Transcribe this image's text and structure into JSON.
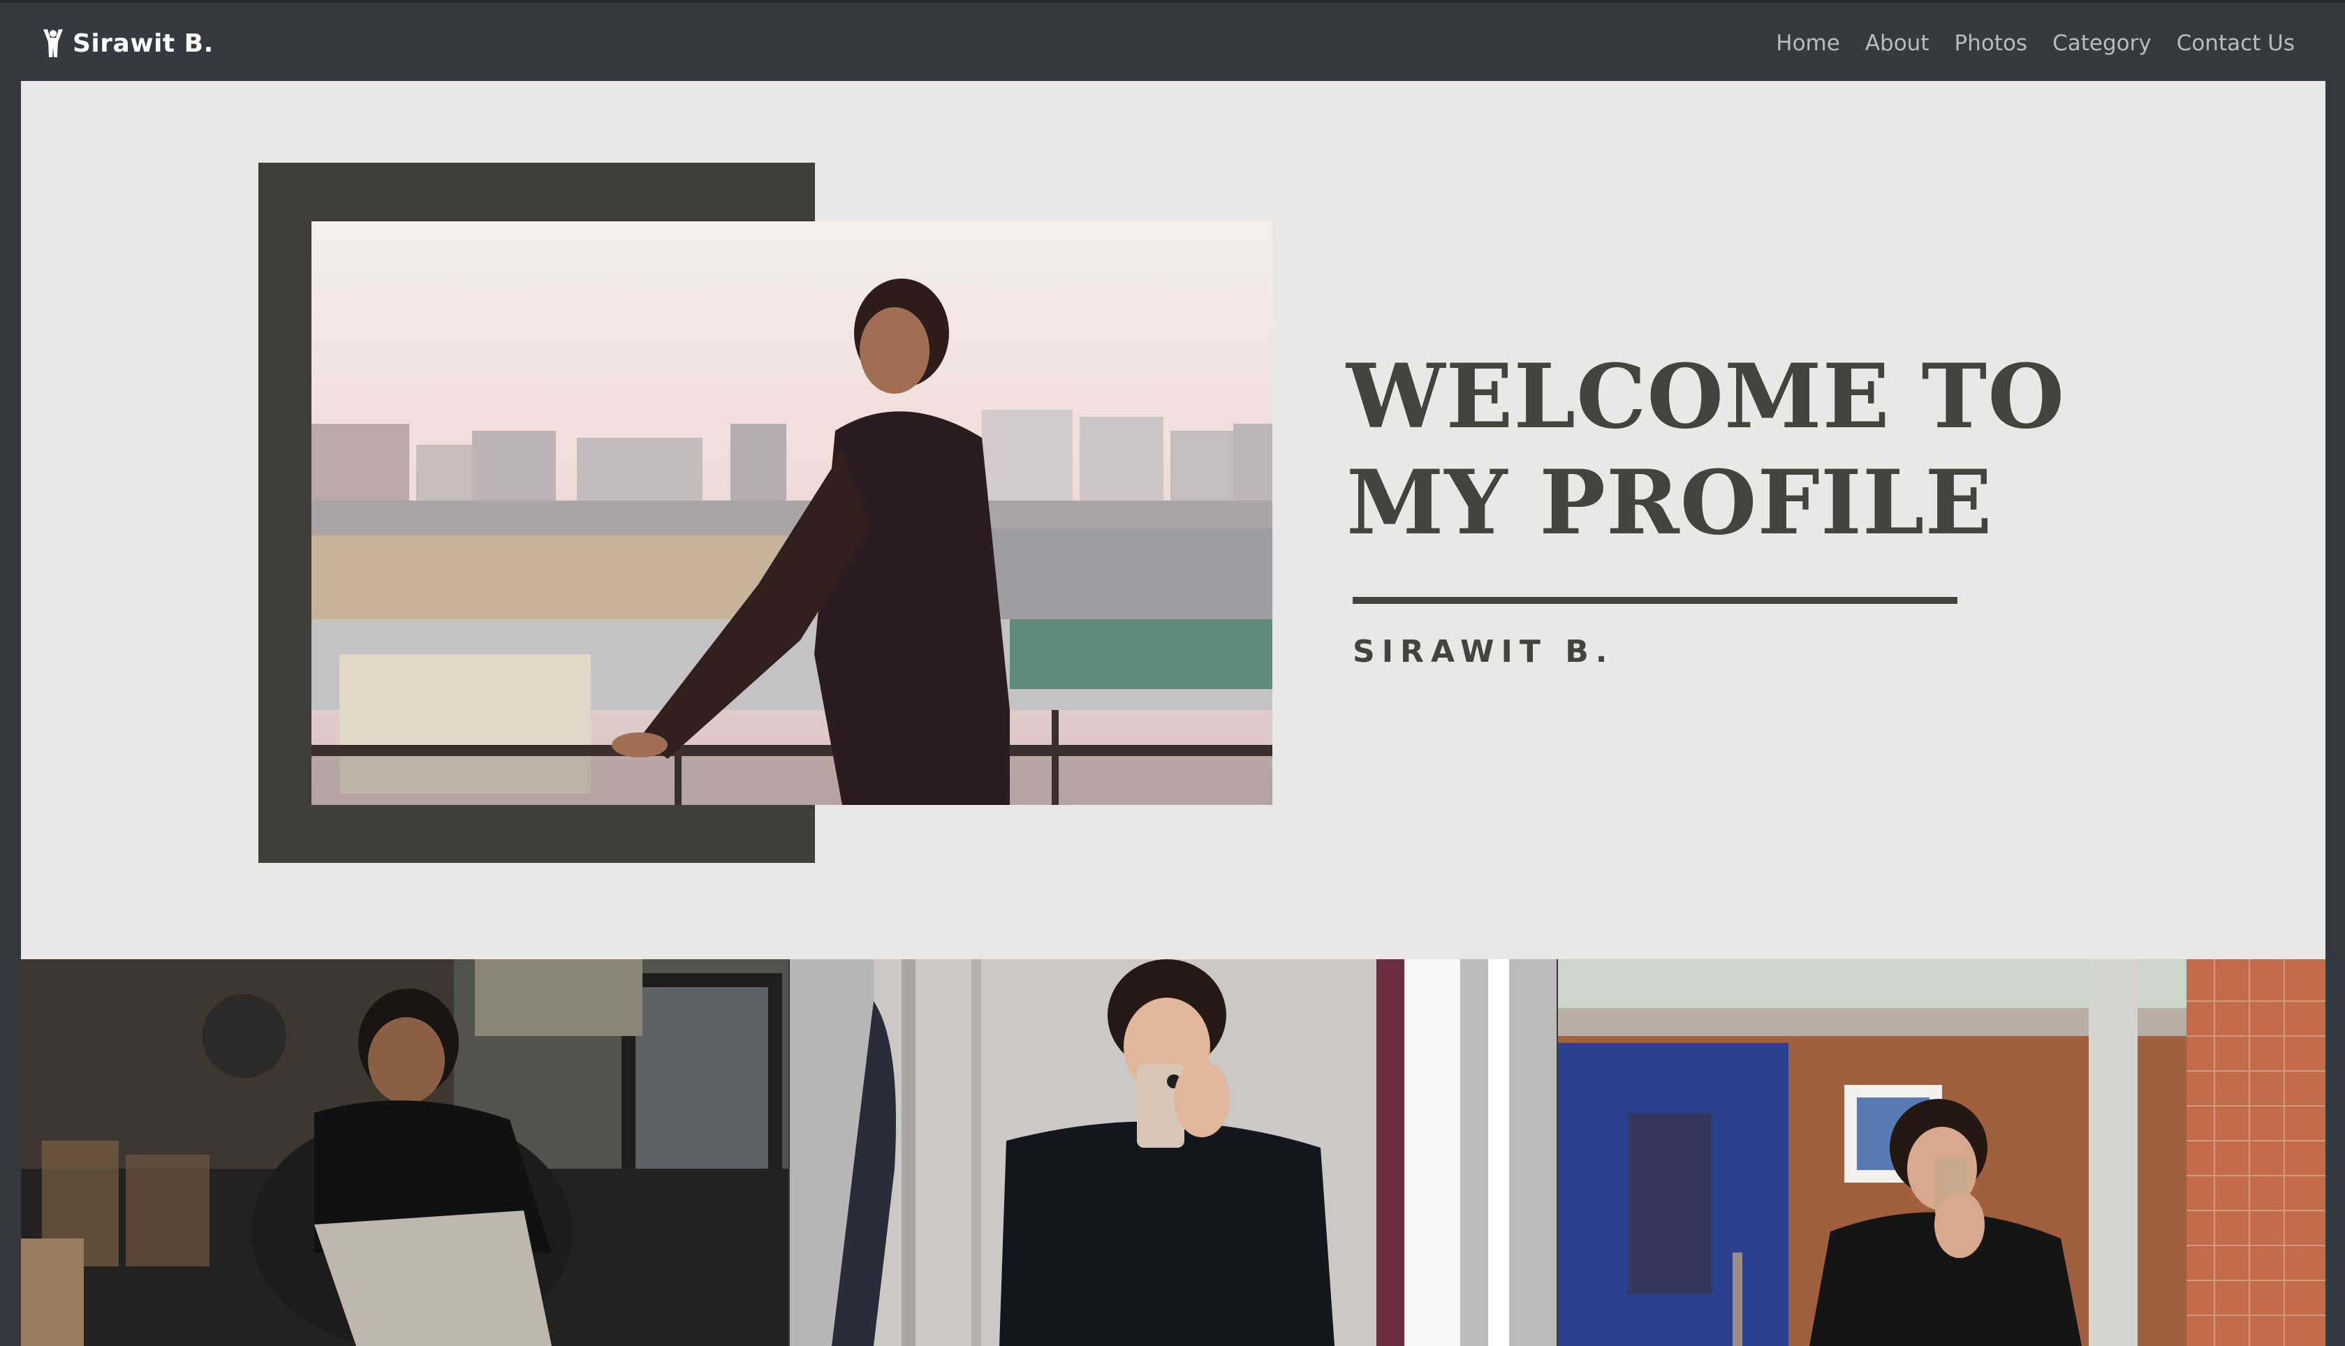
{
  "navbar": {
    "brand_icon": "person-arms-up-icon",
    "brand": "Sirawit B.",
    "links": [
      {
        "label": "Home"
      },
      {
        "label": "About"
      },
      {
        "label": "Photos"
      },
      {
        "label": "Category"
      },
      {
        "label": "Contact Us"
      }
    ]
  },
  "hero": {
    "title_line1": "WELCOME TO",
    "title_line2": "MY PROFILE",
    "subtitle": "SIRAWIT B."
  },
  "gallery": {
    "items": [
      {
        "subject": "man-seated-in-chair"
      },
      {
        "subject": "mirror-selfie-black-tshirt"
      },
      {
        "subject": "mirror-selfie-black-jacket"
      }
    ]
  },
  "colors": {
    "navbar_bg": "#343a40",
    "hero_bg": "#e9e8e6",
    "frame": "#3f3e3b",
    "text_dark": "#45433f",
    "nav_link": "#b9bcbf"
  }
}
